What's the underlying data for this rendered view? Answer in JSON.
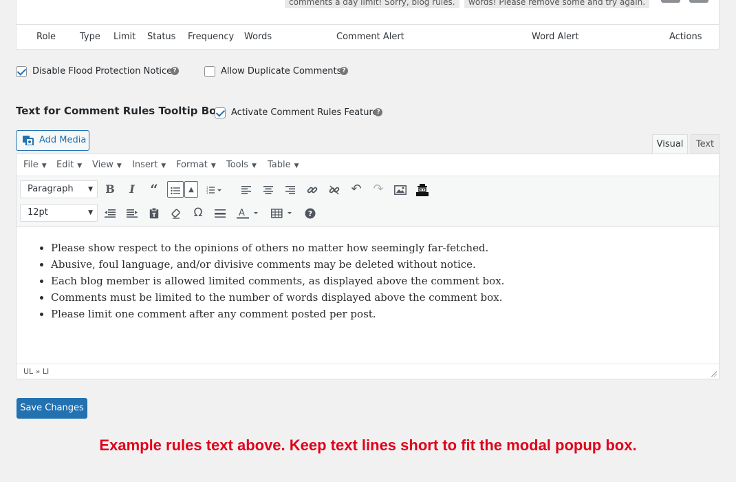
{
  "table": {
    "comment_alert_preview": "comments a day limit! Sorry, blog rules.",
    "word_alert_preview": "words! Please remove some and try again.",
    "headers": [
      "Role",
      "Type",
      "Limit",
      "Status",
      "Frequency",
      "Words",
      "Comment Alert",
      "Word Alert",
      "Actions"
    ]
  },
  "options": {
    "disable_flood": {
      "label": "Disable Flood Protection Notice",
      "checked": true
    },
    "allow_duplicate": {
      "label": "Allow Duplicate Comments",
      "checked": false
    },
    "activate_rules": {
      "label": "Activate Comment Rules Feature",
      "checked": true
    },
    "help_glyph": "?"
  },
  "section_title": "Text for Comment Rules Tooltip Box",
  "editor": {
    "add_media_label": "Add Media",
    "tabs": {
      "visual": "Visual",
      "text": "Text"
    },
    "menu": [
      "File",
      "Edit",
      "View",
      "Insert",
      "Format",
      "Tools",
      "Table"
    ],
    "block_format": "Paragraph",
    "font_size": "12pt",
    "toolbar_row1": [
      "bold-icon",
      "italic-icon",
      "blockquote-icon",
      "bulleted-list-icon",
      "list-options-icon",
      "numbered-list-icon",
      "align-left-icon",
      "align-center-icon",
      "align-right-icon",
      "link-icon",
      "unlink-icon",
      "undo-icon",
      "redo-icon",
      "insert-image-icon",
      "custom-plugin-icon"
    ],
    "toolbar_row2": [
      "outdent-icon",
      "indent-icon",
      "paste-text-icon",
      "clear-formatting-icon",
      "special-character-icon",
      "horizontal-line-icon",
      "text-color-icon",
      "table-icon",
      "help-icon"
    ],
    "content_items": [
      "Please show respect to the opinions of others no matter how seemingly far-fetched.",
      "Abusive, foul language, and/or divisive comments may be deleted without notice.",
      "Each blog member is allowed limited comments, as displayed above the comment box.",
      "Comments must be limited to the number of words displayed above the comment box.",
      "Please limit one comment after any comment posted per post."
    ],
    "element_path": "UL » LI"
  },
  "save_label": "Save Changes",
  "footer_note": "Example rules text above. Keep text lines short to fit the modal popup box.",
  "colors": {
    "accent": "#2271b1",
    "note": "#e0001a"
  }
}
